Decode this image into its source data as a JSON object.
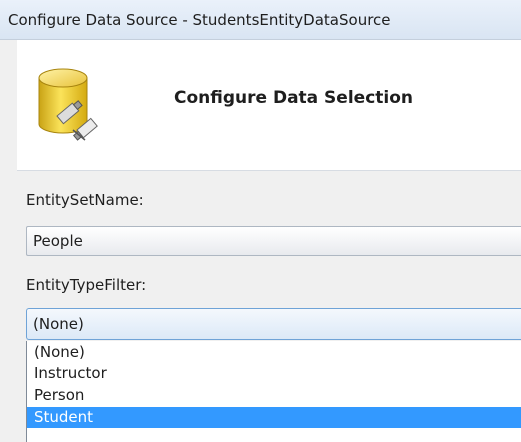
{
  "window": {
    "title": "Configure Data Source - StudentsEntityDataSource"
  },
  "header": {
    "title": "Configure Data Selection",
    "icon": "database-icon"
  },
  "form": {
    "entity_set_label": "EntitySetName:",
    "entity_set_value": "People",
    "entity_type_label": "EntityTypeFilter:",
    "entity_type_value": "(None)",
    "entity_type_options": [
      "(None)",
      "Instructor",
      "Person",
      "Student"
    ],
    "entity_type_selected_option": "Student"
  },
  "colors": {
    "selection": "#3399ff",
    "combo_border": "#6fa3d7"
  }
}
